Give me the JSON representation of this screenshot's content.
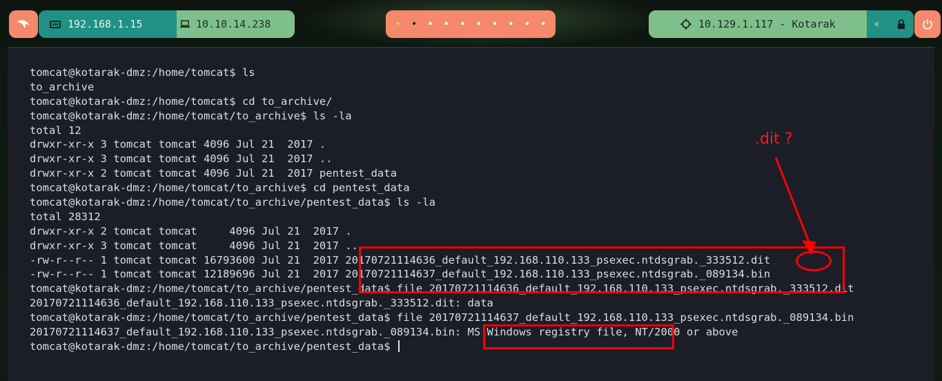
{
  "topbar": {
    "ip_local": "192.168.1.15",
    "ip_vpn": "10.10.14.238",
    "target": "10.129.1.117 - Kotarak",
    "workspaces": [
      "•",
      "•",
      "•",
      "•",
      "•",
      "•",
      "•",
      "•",
      "•",
      "•"
    ]
  },
  "terminal": {
    "lines": [
      "tomcat@kotarak-dmz:/home/tomcat$ ls",
      "to_archive",
      "tomcat@kotarak-dmz:/home/tomcat$ cd to_archive/",
      "tomcat@kotarak-dmz:/home/tomcat/to_archive$ ls -la",
      "total 12",
      "drwxr-xr-x 3 tomcat tomcat 4096 Jul 21  2017 .",
      "drwxr-xr-x 3 tomcat tomcat 4096 Jul 21  2017 ..",
      "drwxr-xr-x 2 tomcat tomcat 4096 Jul 21  2017 pentest_data",
      "tomcat@kotarak-dmz:/home/tomcat/to_archive$ cd pentest_data",
      "tomcat@kotarak-dmz:/home/tomcat/to_archive/pentest_data$ ls -la",
      "total 28312",
      "drwxr-xr-x 2 tomcat tomcat     4096 Jul 21  2017 .",
      "drwxr-xr-x 3 tomcat tomcat     4096 Jul 21  2017 ..",
      "-rw-r--r-- 1 tomcat tomcat 16793600 Jul 21  2017 20170721114636_default_192.168.110.133_psexec.ntdsgrab._333512.dit",
      "-rw-r--r-- 1 tomcat tomcat 12189696 Jul 21  2017 20170721114637_default_192.168.110.133_psexec.ntdsgrab._089134.bin",
      "tomcat@kotarak-dmz:/home/tomcat/to_archive/pentest_data$ file 20170721114636_default_192.168.110.133_psexec.ntdsgrab._333512.dit",
      "20170721114636_default_192.168.110.133_psexec.ntdsgrab._333512.dit: data",
      "tomcat@kotarak-dmz:/home/tomcat/to_archive/pentest_data$ file 20170721114637_default_192.168.110.133_psexec.ntdsgrab._089134.bin",
      "20170721114637_default_192.168.110.133_psexec.ntdsgrab._089134.bin: MS Windows registry file, NT/2000 or above",
      "tomcat@kotarak-dmz:/home/tomcat/to_archive/pentest_data$ "
    ]
  },
  "annotation": {
    "label": ".dit ?",
    "color": "#ff0000"
  },
  "colors": {
    "salmon": "#f4896b",
    "teal": "#1f9185",
    "green": "#7fbf8c",
    "terminal_bg": "#1b1d27",
    "terminal_fg": "#dcdfe4"
  }
}
